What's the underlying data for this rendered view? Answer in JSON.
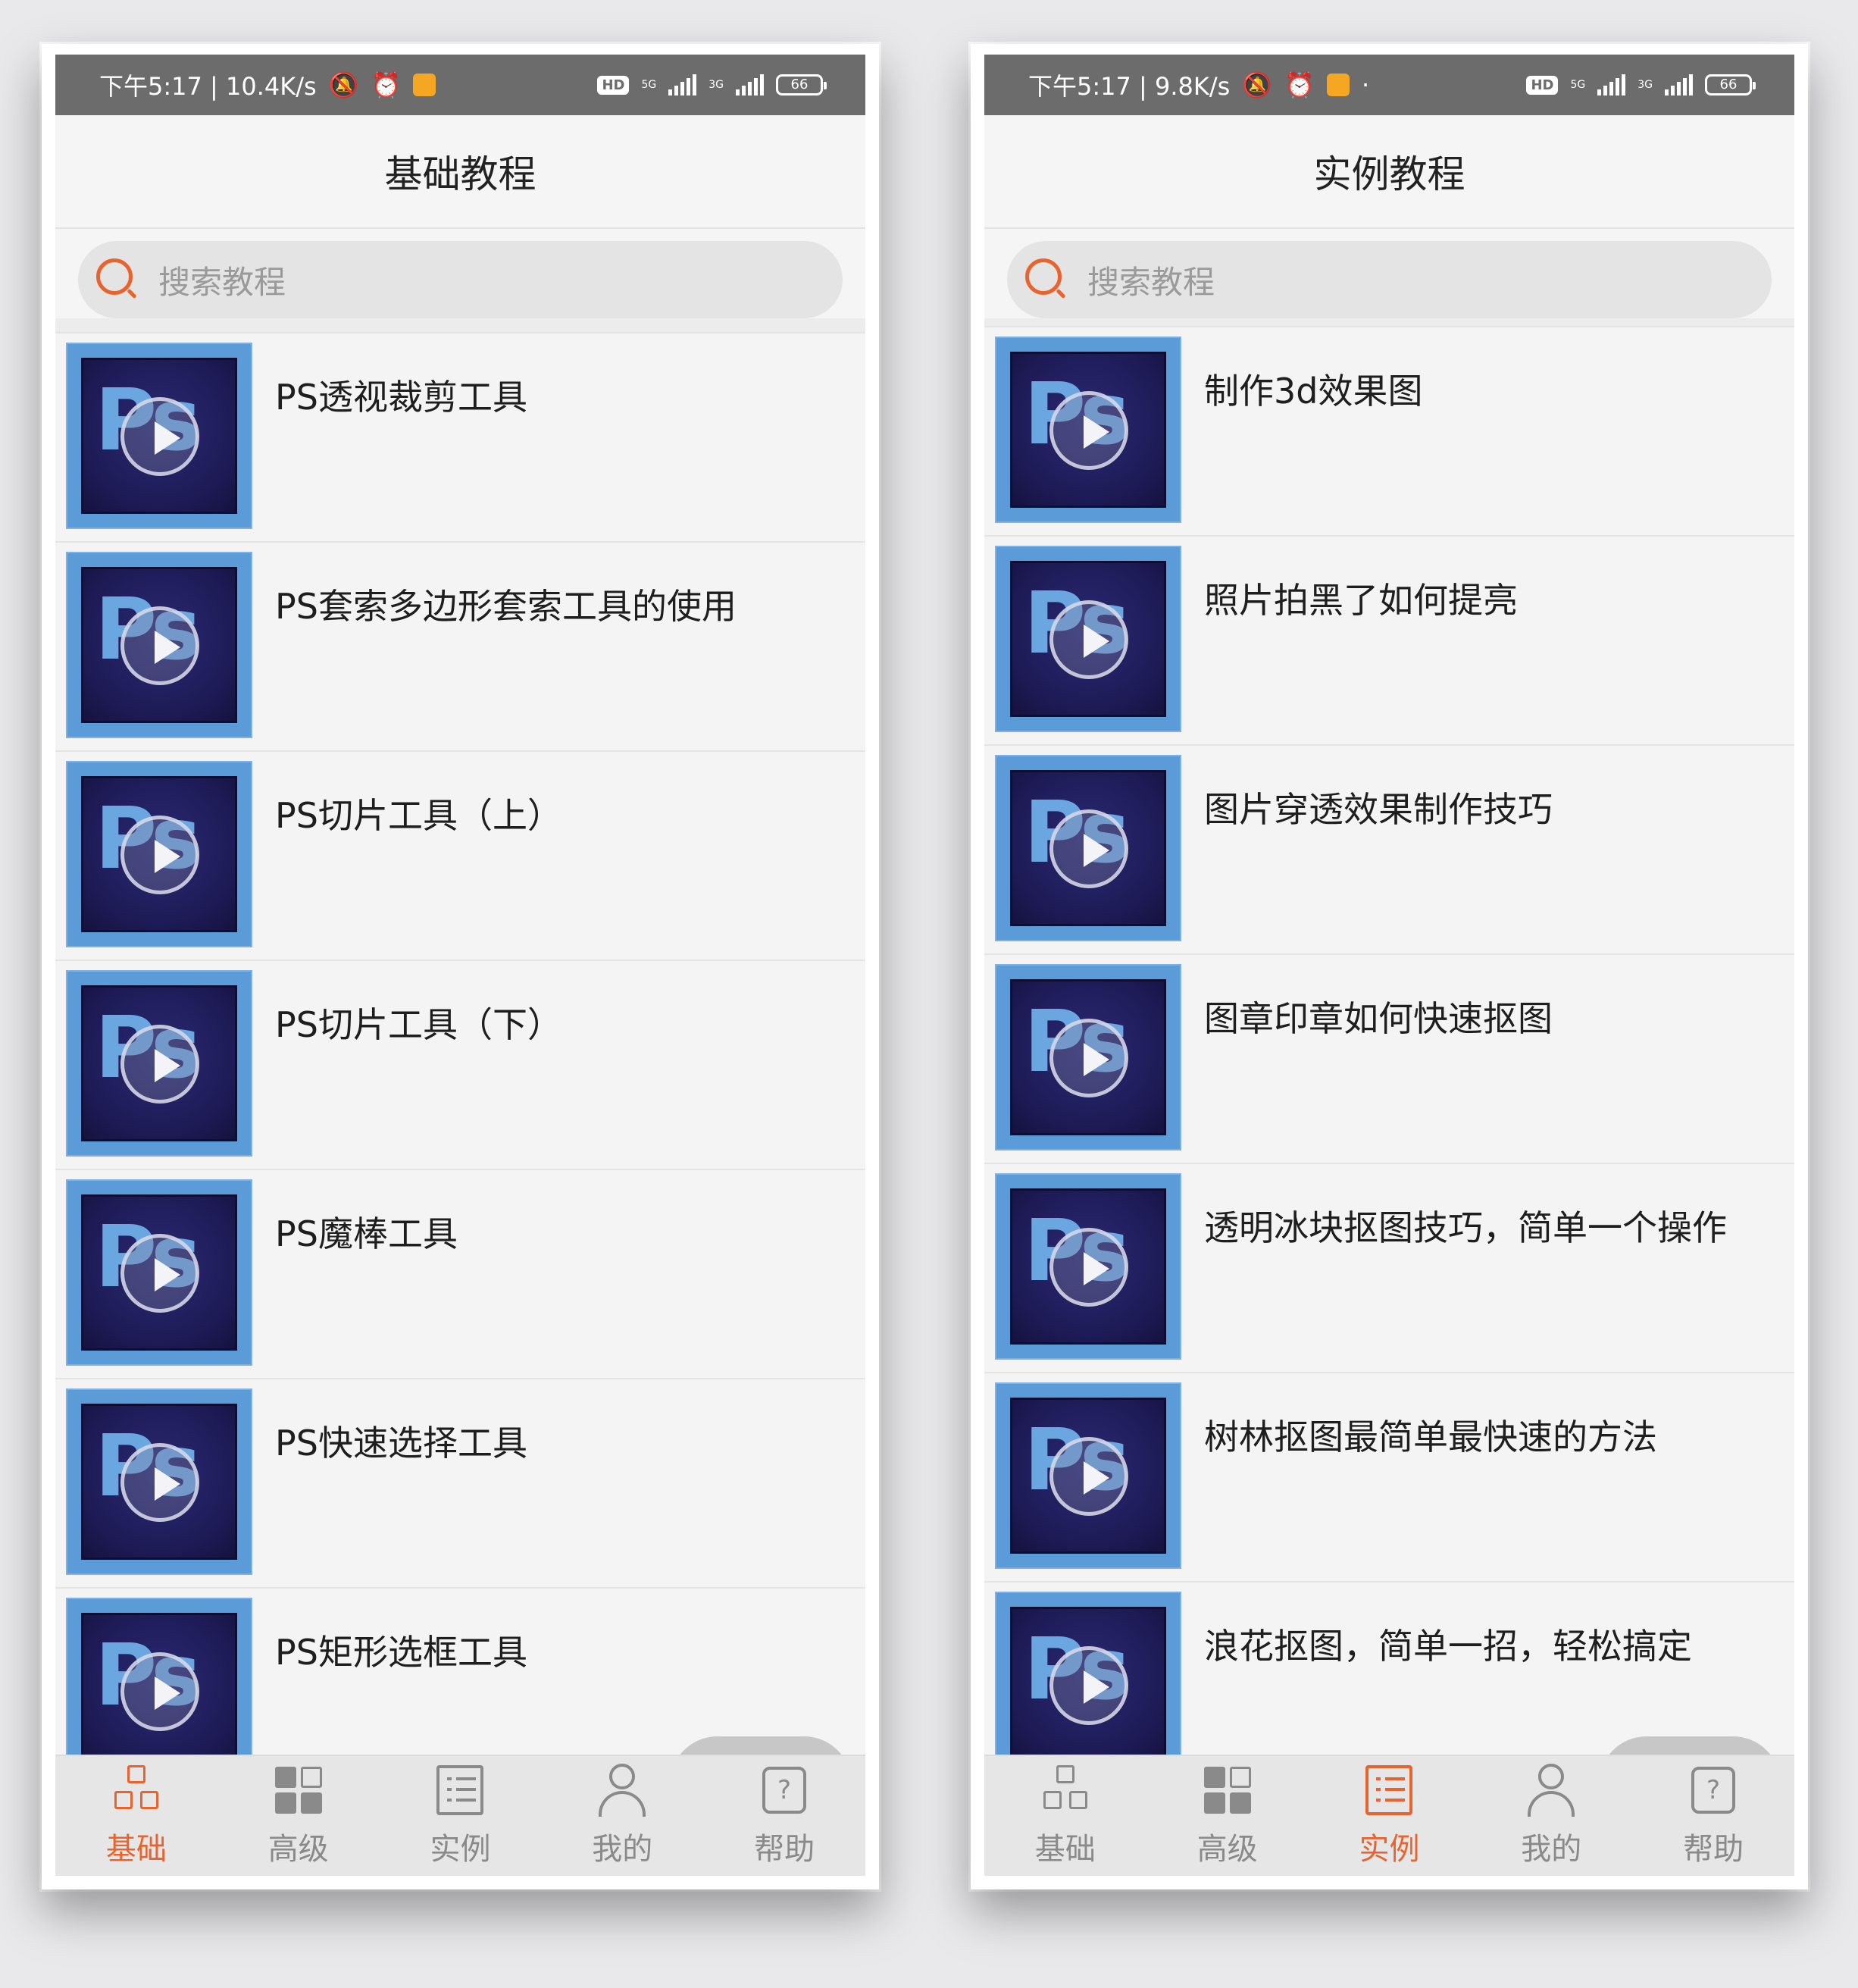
{
  "screens": [
    {
      "status": {
        "time": "下午5:17 | 10.4K/s",
        "battery": "66",
        "hd": "HD",
        "net1": "5G",
        "net2": "3G"
      },
      "title": "基础教程",
      "search_placeholder": "搜索教程",
      "items": [
        "PS透视裁剪工具",
        "PS套索多边形套索工具的使用",
        "PS切片工具（上）",
        "PS切片工具（下）",
        "PS魔棒工具",
        "PS快速选择工具",
        "PS矩形选框工具"
      ],
      "tabs": [
        "基础",
        "高级",
        "实例",
        "我的",
        "帮助"
      ],
      "active_tab": 0
    },
    {
      "status": {
        "time": "下午5:17 | 9.8K/s",
        "battery": "66",
        "hd": "HD",
        "net1": "5G",
        "net2": "3G",
        "extra": "·"
      },
      "title": "实例教程",
      "search_placeholder": "搜索教程",
      "items": [
        "制作3d效果图",
        "照片拍黑了如何提亮",
        "图片穿透效果制作技巧",
        "图章印章如何快速抠图",
        "透明冰块抠图技巧，简单一个操作",
        "树林抠图最简单最快速的方法",
        "浪花抠图，简单一招，轻松搞定"
      ],
      "tabs": [
        "基础",
        "高级",
        "实例",
        "我的",
        "帮助"
      ],
      "active_tab": 2
    }
  ],
  "thumbnail_text": "Ps",
  "icons": {
    "search": "search-icon",
    "play": "play-icon",
    "back_to_top": "arrow-up-icon",
    "tabs": [
      "basic-icon",
      "advanced-grid-icon",
      "examples-list-icon",
      "user-icon",
      "help-icon"
    ]
  },
  "colors": {
    "accent": "#e8642e",
    "statusbar": "#6c6c6c",
    "thumb_border": "#5b9bd8",
    "thumb_bg": "#1d1a55"
  }
}
